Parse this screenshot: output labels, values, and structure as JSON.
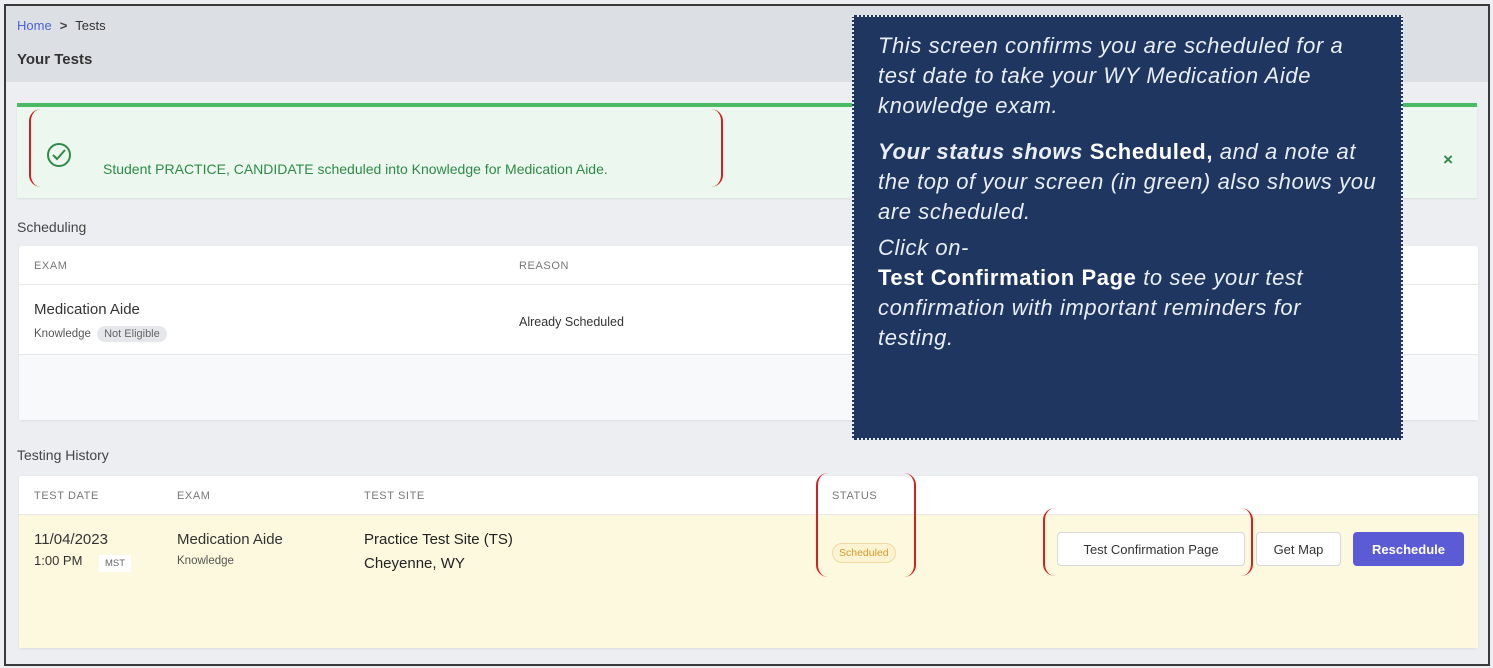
{
  "breadcrumb": {
    "home": "Home",
    "separator": ">",
    "current": "Tests"
  },
  "page_title": "Your Tests",
  "alert": {
    "message": "Student PRACTICE, CANDIDATE scheduled into Knowledge for Medication Aide.",
    "close_symbol": "×",
    "icon": "check-circle-icon",
    "color": "#2e8b45"
  },
  "scheduling": {
    "section_label": "Scheduling",
    "headers": {
      "exam": "EXAM",
      "reason": "REASON"
    },
    "row": {
      "exam": "Medication Aide",
      "type": "Knowledge",
      "eligibility": "Not Eligible",
      "reason": "Already Scheduled"
    }
  },
  "history": {
    "section_label": "Testing History",
    "headers": {
      "date": "TEST DATE",
      "exam": "EXAM",
      "site": "TEST SITE",
      "status": "STATUS"
    },
    "row": {
      "date": "11/04/2023",
      "time": "1:00 PM",
      "timezone": "MST",
      "exam": "Medication Aide",
      "type": "Knowledge",
      "site_name": "Practice Test Site (TS)",
      "site_location": "Cheyenne, WY",
      "status": "Scheduled"
    },
    "buttons": {
      "confirmation": "Test Confirmation Page",
      "map": "Get Map",
      "reschedule": "Reschedule"
    }
  },
  "callout": {
    "p1": "This screen confirms you are scheduled for a test date to take your WY Medication Aide knowledge exam.",
    "p2_lead": "Your status shows",
    "p2_bold": "Scheduled,",
    "p2_rest": "and a note at the top of your screen (in green) also shows you are scheduled.",
    "p3_lead": "Click on-",
    "p3_bold": "Test Confirmation Page",
    "p3_rest": "to see your test confirmation with important reminders for testing."
  },
  "colors": {
    "primary_button": "#5b5bd6",
    "callout_background": "#1f3760",
    "highlight_bracket": "#d61f1f",
    "scheduled_row": "#fdf9df"
  }
}
